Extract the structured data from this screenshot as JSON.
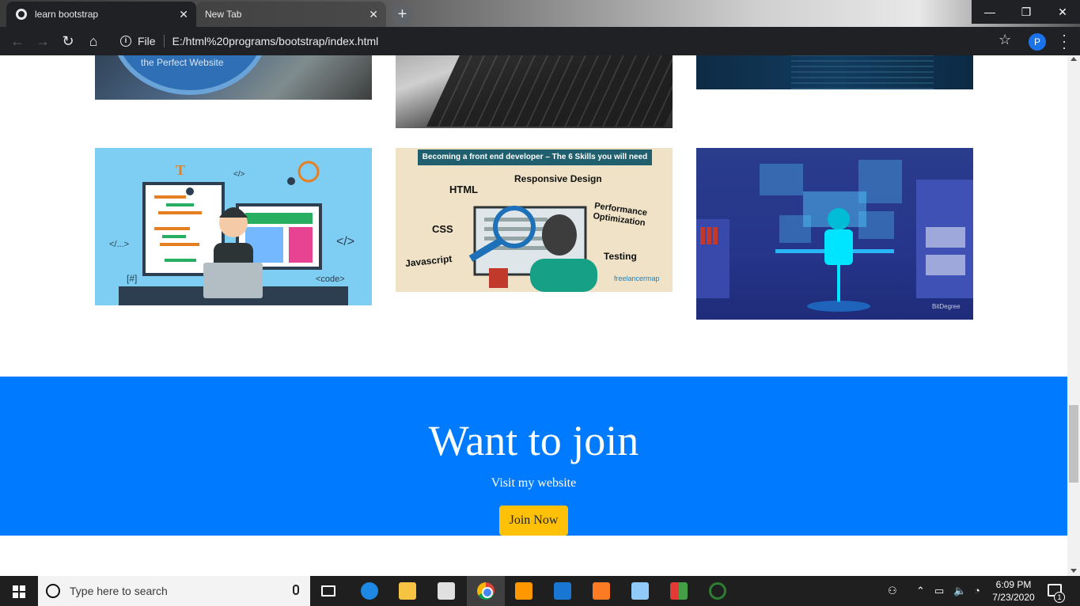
{
  "browser": {
    "tabs": [
      {
        "title": "learn bootstrap",
        "active": true
      },
      {
        "title": "New Tab",
        "active": false
      }
    ],
    "new_tab_symbol": "+",
    "scheme_label": "File",
    "url": "E:/html%20programs/bootstrap/index.html",
    "profile_initial": "P"
  },
  "gallery": {
    "row1": [
      {
        "caption": "the Perfect Website"
      },
      {
        "caption": ""
      },
      {
        "caption": ""
      }
    ],
    "row2": [
      {
        "labels": [
          "T",
          "</>",
          "</...>",
          "[#]",
          "<code>",
          "</>"
        ]
      },
      {
        "banner": "Becoming a front end developer – The 6 Skills you will need",
        "skills": [
          "HTML",
          "Responsive Design",
          "Performance Optimization",
          "CSS",
          "Javascript",
          "Testing"
        ],
        "brand": "freelancermap"
      },
      {
        "brand": "BitDegree"
      }
    ]
  },
  "jumbotron": {
    "title": "Want to join",
    "subtitle": "Visit my website",
    "button": "Join Now"
  },
  "taskbar": {
    "search_placeholder": "Type here to search",
    "time": "6:09 PM",
    "date": "7/23/2020",
    "notification_count": "1"
  },
  "colors": {
    "jumbotron_bg": "#007bff",
    "join_button_bg": "#ffc107",
    "chrome_dark": "#202124"
  }
}
